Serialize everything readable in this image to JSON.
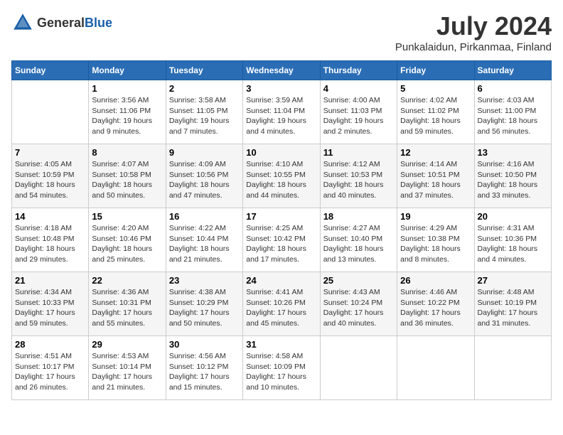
{
  "header": {
    "logo_general": "General",
    "logo_blue": "Blue",
    "month_year": "July 2024",
    "location": "Punkalaidun, Pirkanmaa, Finland"
  },
  "days_of_week": [
    "Sunday",
    "Monday",
    "Tuesday",
    "Wednesday",
    "Thursday",
    "Friday",
    "Saturday"
  ],
  "weeks": [
    [
      {
        "day": "",
        "sunrise": "",
        "sunset": "",
        "daylight": ""
      },
      {
        "day": "1",
        "sunrise": "Sunrise: 3:56 AM",
        "sunset": "Sunset: 11:06 PM",
        "daylight": "Daylight: 19 hours and 9 minutes."
      },
      {
        "day": "2",
        "sunrise": "Sunrise: 3:58 AM",
        "sunset": "Sunset: 11:05 PM",
        "daylight": "Daylight: 19 hours and 7 minutes."
      },
      {
        "day": "3",
        "sunrise": "Sunrise: 3:59 AM",
        "sunset": "Sunset: 11:04 PM",
        "daylight": "Daylight: 19 hours and 4 minutes."
      },
      {
        "day": "4",
        "sunrise": "Sunrise: 4:00 AM",
        "sunset": "Sunset: 11:03 PM",
        "daylight": "Daylight: 19 hours and 2 minutes."
      },
      {
        "day": "5",
        "sunrise": "Sunrise: 4:02 AM",
        "sunset": "Sunset: 11:02 PM",
        "daylight": "Daylight: 18 hours and 59 minutes."
      },
      {
        "day": "6",
        "sunrise": "Sunrise: 4:03 AM",
        "sunset": "Sunset: 11:00 PM",
        "daylight": "Daylight: 18 hours and 56 minutes."
      }
    ],
    [
      {
        "day": "7",
        "sunrise": "Sunrise: 4:05 AM",
        "sunset": "Sunset: 10:59 PM",
        "daylight": "Daylight: 18 hours and 54 minutes."
      },
      {
        "day": "8",
        "sunrise": "Sunrise: 4:07 AM",
        "sunset": "Sunset: 10:58 PM",
        "daylight": "Daylight: 18 hours and 50 minutes."
      },
      {
        "day": "9",
        "sunrise": "Sunrise: 4:09 AM",
        "sunset": "Sunset: 10:56 PM",
        "daylight": "Daylight: 18 hours and 47 minutes."
      },
      {
        "day": "10",
        "sunrise": "Sunrise: 4:10 AM",
        "sunset": "Sunset: 10:55 PM",
        "daylight": "Daylight: 18 hours and 44 minutes."
      },
      {
        "day": "11",
        "sunrise": "Sunrise: 4:12 AM",
        "sunset": "Sunset: 10:53 PM",
        "daylight": "Daylight: 18 hours and 40 minutes."
      },
      {
        "day": "12",
        "sunrise": "Sunrise: 4:14 AM",
        "sunset": "Sunset: 10:51 PM",
        "daylight": "Daylight: 18 hours and 37 minutes."
      },
      {
        "day": "13",
        "sunrise": "Sunrise: 4:16 AM",
        "sunset": "Sunset: 10:50 PM",
        "daylight": "Daylight: 18 hours and 33 minutes."
      }
    ],
    [
      {
        "day": "14",
        "sunrise": "Sunrise: 4:18 AM",
        "sunset": "Sunset: 10:48 PM",
        "daylight": "Daylight: 18 hours and 29 minutes."
      },
      {
        "day": "15",
        "sunrise": "Sunrise: 4:20 AM",
        "sunset": "Sunset: 10:46 PM",
        "daylight": "Daylight: 18 hours and 25 minutes."
      },
      {
        "day": "16",
        "sunrise": "Sunrise: 4:22 AM",
        "sunset": "Sunset: 10:44 PM",
        "daylight": "Daylight: 18 hours and 21 minutes."
      },
      {
        "day": "17",
        "sunrise": "Sunrise: 4:25 AM",
        "sunset": "Sunset: 10:42 PM",
        "daylight": "Daylight: 18 hours and 17 minutes."
      },
      {
        "day": "18",
        "sunrise": "Sunrise: 4:27 AM",
        "sunset": "Sunset: 10:40 PM",
        "daylight": "Daylight: 18 hours and 13 minutes."
      },
      {
        "day": "19",
        "sunrise": "Sunrise: 4:29 AM",
        "sunset": "Sunset: 10:38 PM",
        "daylight": "Daylight: 18 hours and 8 minutes."
      },
      {
        "day": "20",
        "sunrise": "Sunrise: 4:31 AM",
        "sunset": "Sunset: 10:36 PM",
        "daylight": "Daylight: 18 hours and 4 minutes."
      }
    ],
    [
      {
        "day": "21",
        "sunrise": "Sunrise: 4:34 AM",
        "sunset": "Sunset: 10:33 PM",
        "daylight": "Daylight: 17 hours and 59 minutes."
      },
      {
        "day": "22",
        "sunrise": "Sunrise: 4:36 AM",
        "sunset": "Sunset: 10:31 PM",
        "daylight": "Daylight: 17 hours and 55 minutes."
      },
      {
        "day": "23",
        "sunrise": "Sunrise: 4:38 AM",
        "sunset": "Sunset: 10:29 PM",
        "daylight": "Daylight: 17 hours and 50 minutes."
      },
      {
        "day": "24",
        "sunrise": "Sunrise: 4:41 AM",
        "sunset": "Sunset: 10:26 PM",
        "daylight": "Daylight: 17 hours and 45 minutes."
      },
      {
        "day": "25",
        "sunrise": "Sunrise: 4:43 AM",
        "sunset": "Sunset: 10:24 PM",
        "daylight": "Daylight: 17 hours and 40 minutes."
      },
      {
        "day": "26",
        "sunrise": "Sunrise: 4:46 AM",
        "sunset": "Sunset: 10:22 PM",
        "daylight": "Daylight: 17 hours and 36 minutes."
      },
      {
        "day": "27",
        "sunrise": "Sunrise: 4:48 AM",
        "sunset": "Sunset: 10:19 PM",
        "daylight": "Daylight: 17 hours and 31 minutes."
      }
    ],
    [
      {
        "day": "28",
        "sunrise": "Sunrise: 4:51 AM",
        "sunset": "Sunset: 10:17 PM",
        "daylight": "Daylight: 17 hours and 26 minutes."
      },
      {
        "day": "29",
        "sunrise": "Sunrise: 4:53 AM",
        "sunset": "Sunset: 10:14 PM",
        "daylight": "Daylight: 17 hours and 21 minutes."
      },
      {
        "day": "30",
        "sunrise": "Sunrise: 4:56 AM",
        "sunset": "Sunset: 10:12 PM",
        "daylight": "Daylight: 17 hours and 15 minutes."
      },
      {
        "day": "31",
        "sunrise": "Sunrise: 4:58 AM",
        "sunset": "Sunset: 10:09 PM",
        "daylight": "Daylight: 17 hours and 10 minutes."
      },
      {
        "day": "",
        "sunrise": "",
        "sunset": "",
        "daylight": ""
      },
      {
        "day": "",
        "sunrise": "",
        "sunset": "",
        "daylight": ""
      },
      {
        "day": "",
        "sunrise": "",
        "sunset": "",
        "daylight": ""
      }
    ]
  ]
}
